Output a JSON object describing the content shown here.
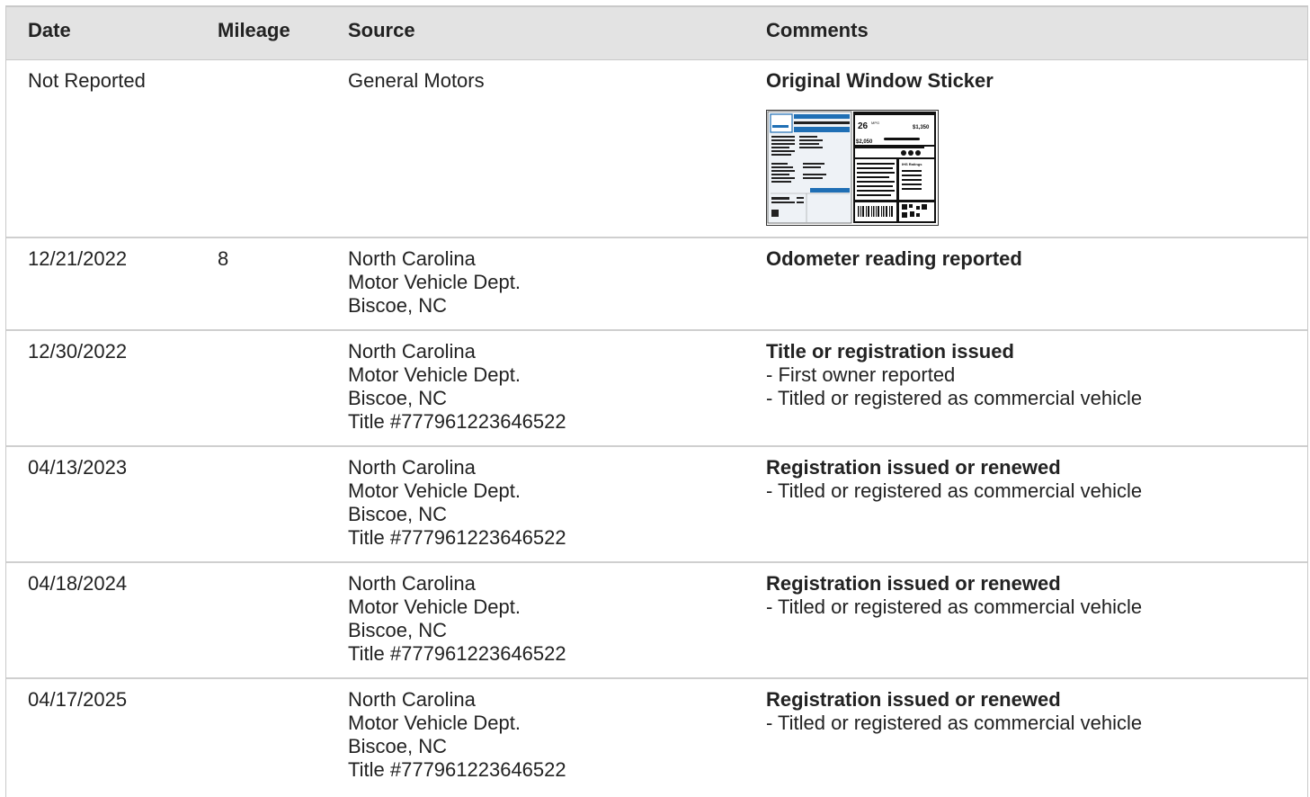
{
  "headers": {
    "date": "Date",
    "mileage": "Mileage",
    "source": "Source",
    "comments": "Comments"
  },
  "rows": [
    {
      "date": "Not Reported",
      "mileage": "",
      "source": [
        "General Motors"
      ],
      "comment_title": "Original Window Sticker",
      "comment_lines": [],
      "has_sticker": true
    },
    {
      "date": "12/21/2022",
      "mileage": "8",
      "source": [
        "North Carolina",
        "Motor Vehicle Dept.",
        "Biscoe, NC"
      ],
      "comment_title": "Odometer reading reported",
      "comment_lines": []
    },
    {
      "date": "12/30/2022",
      "mileage": "",
      "source": [
        "North Carolina",
        "Motor Vehicle Dept.",
        "Biscoe, NC",
        "Title #777961223646522"
      ],
      "comment_title": "Title or registration issued",
      "comment_lines": [
        "- First owner reported",
        "- Titled or registered as commercial vehicle"
      ]
    },
    {
      "date": "04/13/2023",
      "mileage": "",
      "source": [
        "North Carolina",
        "Motor Vehicle Dept.",
        "Biscoe, NC",
        "Title #777961223646522"
      ],
      "comment_title": "Registration issued or renewed",
      "comment_lines": [
        "- Titled or registered as commercial vehicle"
      ]
    },
    {
      "date": "04/18/2024",
      "mileage": "",
      "source": [
        "North Carolina",
        "Motor Vehicle Dept.",
        "Biscoe, NC",
        "Title #777961223646522"
      ],
      "comment_title": "Registration issued or renewed",
      "comment_lines": [
        "- Titled or registered as commercial vehicle"
      ]
    },
    {
      "date": "04/17/2025",
      "mileage": "",
      "source": [
        "North Carolina",
        "Motor Vehicle Dept.",
        "Biscoe, NC",
        "Title #777961223646522"
      ],
      "comment_title": "Registration issued or renewed",
      "comment_lines": [
        "- Titled or registered as commercial vehicle"
      ]
    }
  ],
  "sticker": {
    "mpg": "26",
    "mpg_unit": "MPG",
    "save": "$1,350",
    "cost": "$2,050",
    "ratings": "IHS Ratings"
  }
}
